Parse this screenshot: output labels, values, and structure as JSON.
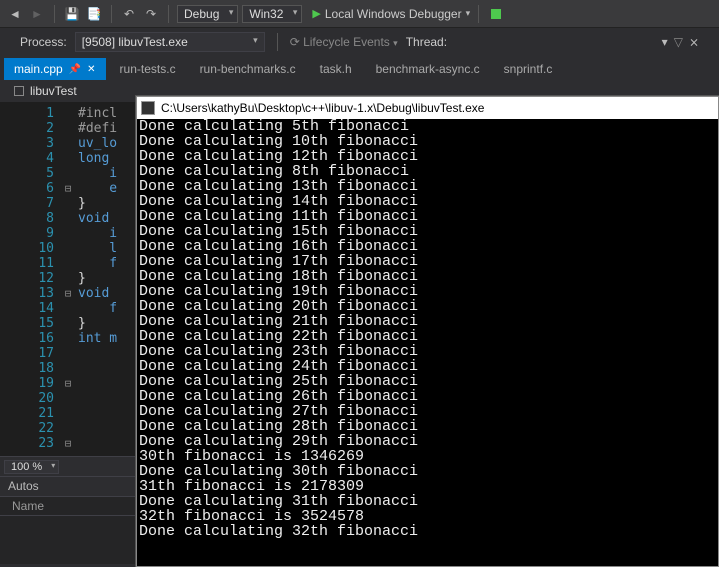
{
  "toolbar": {
    "config_label": "Debug",
    "platform_label": "Win32",
    "debugger_label": "Local Windows Debugger"
  },
  "process_row": {
    "label": "Process:",
    "process_text": "[9508] libuvTest.exe",
    "lifecycle_label": "Lifecycle Events",
    "thread_label": "Thread:"
  },
  "tabs": [
    {
      "label": "main.cpp",
      "active": true
    },
    {
      "label": "run-tests.c"
    },
    {
      "label": "run-benchmarks.c"
    },
    {
      "label": "task.h"
    },
    {
      "label": "benchmark-async.c"
    },
    {
      "label": "snprintf.c"
    }
  ],
  "project_title": "libuvTest",
  "editor": {
    "line_numbers": [
      "1",
      "2",
      "3",
      "4",
      "5",
      "6",
      "7",
      "8",
      "9",
      "10",
      "11",
      "12",
      "13",
      "14",
      "15",
      "16",
      "17",
      "18",
      "19",
      "20",
      "21",
      "22",
      "23"
    ],
    "outline": [
      "",
      "",
      "",
      "",
      "",
      "⊟",
      "",
      "",
      "",
      "",
      "",
      "",
      "⊟",
      "",
      "",
      "",
      "",
      "",
      "⊟",
      "",
      "",
      "",
      "⊟"
    ],
    "code_lines": [
      {
        "t": "#incl",
        "c": "pp"
      },
      {
        "t": ""
      },
      {
        "t": "#defi",
        "c": "pp"
      },
      {
        "t": "uv_lo",
        "c": "kw"
      },
      {
        "t": ""
      },
      {
        "t": "long ",
        "c": "kw"
      },
      {
        "t": "    i",
        "c": "kw"
      },
      {
        "t": ""
      },
      {
        "t": "    e",
        "c": "kw"
      },
      {
        "t": ""
      },
      {
        "t": "}"
      },
      {
        "t": ""
      },
      {
        "t": "void ",
        "c": "kw"
      },
      {
        "t": "    i",
        "c": "kw"
      },
      {
        "t": "    l",
        "c": "kw"
      },
      {
        "t": "    f",
        "c": "kw"
      },
      {
        "t": "}"
      },
      {
        "t": ""
      },
      {
        "t": "void ",
        "c": "kw"
      },
      {
        "t": "    f",
        "c": "kw"
      },
      {
        "t": "}"
      },
      {
        "t": ""
      },
      {
        "t": "int m",
        "c": "kw"
      }
    ],
    "zoom": "100 %"
  },
  "autos": {
    "panel_title": "Autos",
    "col_name": "Name"
  },
  "console": {
    "title": "C:\\Users\\kathyBu\\Desktop\\c++\\libuv-1.x\\Debug\\libuvTest.exe",
    "lines": [
      "Done calculating 5th fibonacci",
      "Done calculating 10th fibonacci",
      "Done calculating 12th fibonacci",
      "Done calculating 8th fibonacci",
      "Done calculating 13th fibonacci",
      "Done calculating 14th fibonacci",
      "Done calculating 11th fibonacci",
      "Done calculating 15th fibonacci",
      "Done calculating 16th fibonacci",
      "Done calculating 17th fibonacci",
      "Done calculating 18th fibonacci",
      "Done calculating 19th fibonacci",
      "Done calculating 20th fibonacci",
      "Done calculating 21th fibonacci",
      "Done calculating 22th fibonacci",
      "Done calculating 23th fibonacci",
      "Done calculating 24th fibonacci",
      "Done calculating 25th fibonacci",
      "Done calculating 26th fibonacci",
      "Done calculating 27th fibonacci",
      "Done calculating 28th fibonacci",
      "Done calculating 29th fibonacci",
      "30th fibonacci is 1346269",
      "Done calculating 30th fibonacci",
      "31th fibonacci is 2178309",
      "Done calculating 31th fibonacci",
      "32th fibonacci is 3524578",
      "Done calculating 32th fibonacci"
    ]
  }
}
